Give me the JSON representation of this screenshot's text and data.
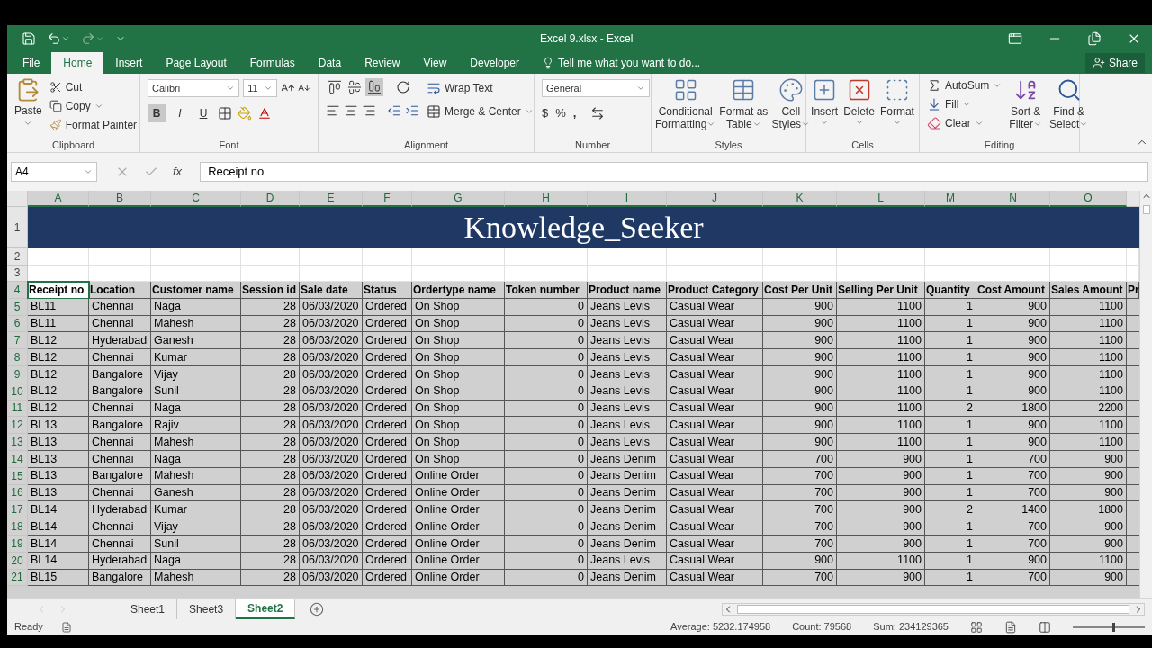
{
  "window": {
    "title": "Excel 9.xlsx - Excel"
  },
  "ribbon_tabs": [
    {
      "label": "File",
      "selected": false
    },
    {
      "label": "Home",
      "selected": true
    },
    {
      "label": "Insert",
      "selected": false
    },
    {
      "label": "Page Layout",
      "selected": false
    },
    {
      "label": "Formulas",
      "selected": false
    },
    {
      "label": "Data",
      "selected": false
    },
    {
      "label": "Review",
      "selected": false
    },
    {
      "label": "View",
      "selected": false
    },
    {
      "label": "Developer",
      "selected": false
    }
  ],
  "tell_me": "Tell me what you want to do...",
  "share": "Share",
  "clipboard": {
    "label": "Clipboard",
    "paste": "Paste",
    "cut": "Cut",
    "copy": "Copy",
    "format_painter": "Format Painter"
  },
  "font": {
    "label": "Font",
    "name": "Calibri",
    "size": "11",
    "styles": [
      {
        "label": "B",
        "on": true
      },
      {
        "label": "I",
        "on": false
      },
      {
        "label": "U",
        "on": false
      }
    ]
  },
  "alignment": {
    "label": "Alignment",
    "vertical": [
      {
        "on": false
      },
      {
        "on": false
      },
      {
        "on": true
      }
    ],
    "wrap_text": "Wrap Text",
    "merge": "Merge & Center"
  },
  "number": {
    "label": "Number",
    "format": "General",
    "currency": "$",
    "percent": "%",
    "comma": ","
  },
  "styles": {
    "label": "Styles",
    "buttons": [
      [
        "Conditional",
        "Formatting"
      ],
      [
        "Format as",
        "Table"
      ],
      [
        "Cell",
        "Styles"
      ]
    ]
  },
  "cells": {
    "label": "Cells",
    "buttons": [
      "Insert",
      "Delete",
      "Format"
    ]
  },
  "editing": {
    "label": "Editing",
    "autosum": "AutoSum",
    "fill": "Fill",
    "clear": "Clear",
    "sort": [
      "Sort &",
      "Filter"
    ],
    "find": [
      "Find &",
      "Select"
    ]
  },
  "formula_bar": {
    "name_box": "A4",
    "fx": "fx",
    "formula": "Receipt no"
  },
  "columns": [
    {
      "letter": "A",
      "selected": true
    },
    {
      "letter": "B",
      "selected": true
    },
    {
      "letter": "C",
      "selected": true
    },
    {
      "letter": "D",
      "selected": true
    },
    {
      "letter": "E",
      "selected": true
    },
    {
      "letter": "F",
      "selected": true
    },
    {
      "letter": "G",
      "selected": true
    },
    {
      "letter": "H",
      "selected": true
    },
    {
      "letter": "I",
      "selected": true
    },
    {
      "letter": "J",
      "selected": true
    },
    {
      "letter": "K",
      "selected": true
    },
    {
      "letter": "L",
      "selected": true
    },
    {
      "letter": "M",
      "selected": true
    },
    {
      "letter": "N",
      "selected": true
    },
    {
      "letter": "O",
      "selected": true
    }
  ],
  "title_row": {
    "number": "1",
    "selected": false,
    "text": "Knowledge_Seeker"
  },
  "blank_rows": [
    {
      "number": "2",
      "selected": false
    },
    {
      "number": "3",
      "selected": false
    }
  ],
  "header_row": {
    "number": "4",
    "selected": true,
    "cells": [
      {
        "text": "Receipt no",
        "active": true
      },
      {
        "text": "Location",
        "active": false
      },
      {
        "text": "Customer name",
        "active": false
      },
      {
        "text": "Session id",
        "active": false
      },
      {
        "text": "Sale date",
        "active": false
      },
      {
        "text": "Status",
        "active": false
      },
      {
        "text": "Ordertype name",
        "active": false
      },
      {
        "text": "Token number",
        "active": false
      },
      {
        "text": "Product name",
        "active": false
      },
      {
        "text": "Product Category",
        "active": false
      },
      {
        "text": "Cost Per Unit",
        "active": false
      },
      {
        "text": "Selling Per Unit",
        "active": false
      },
      {
        "text": "Quantity",
        "active": false
      },
      {
        "text": "Cost Amount",
        "active": false
      },
      {
        "text": "Sales Amount",
        "active": false
      },
      {
        "text": "Pr",
        "active": false
      }
    ]
  },
  "rows": [
    {
      "number": "5",
      "selected": true,
      "cells": [
        "BL11",
        "Chennai",
        "Naga",
        "28",
        "06/03/2020",
        "Ordered",
        "On Shop",
        "0",
        "Jeans Levis",
        "Casual Wear",
        "900",
        "1100",
        "1",
        "900",
        "1100"
      ]
    },
    {
      "number": "6",
      "selected": true,
      "cells": [
        "BL11",
        "Chennai",
        "Mahesh",
        "28",
        "06/03/2020",
        "Ordered",
        "On Shop",
        "0",
        "Jeans Levis",
        "Casual Wear",
        "900",
        "1100",
        "1",
        "900",
        "1100"
      ]
    },
    {
      "number": "7",
      "selected": true,
      "cells": [
        "BL12",
        "Hyderabad",
        "Ganesh",
        "28",
        "06/03/2020",
        "Ordered",
        "On Shop",
        "0",
        "Jeans Levis",
        "Casual Wear",
        "900",
        "1100",
        "1",
        "900",
        "1100"
      ]
    },
    {
      "number": "8",
      "selected": true,
      "cells": [
        "BL12",
        "Chennai",
        "Kumar",
        "28",
        "06/03/2020",
        "Ordered",
        "On Shop",
        "0",
        "Jeans Levis",
        "Casual Wear",
        "900",
        "1100",
        "1",
        "900",
        "1100"
      ]
    },
    {
      "number": "9",
      "selected": true,
      "cells": [
        "BL12",
        "Bangalore",
        "Vijay",
        "28",
        "06/03/2020",
        "Ordered",
        "On Shop",
        "0",
        "Jeans Levis",
        "Casual Wear",
        "900",
        "1100",
        "1",
        "900",
        "1100"
      ]
    },
    {
      "number": "10",
      "selected": true,
      "cells": [
        "BL12",
        "Bangalore",
        "Sunil",
        "28",
        "06/03/2020",
        "Ordered",
        "On Shop",
        "0",
        "Jeans Levis",
        "Casual Wear",
        "900",
        "1100",
        "1",
        "900",
        "1100"
      ]
    },
    {
      "number": "11",
      "selected": true,
      "cells": [
        "BL12",
        "Chennai",
        "Naga",
        "28",
        "06/03/2020",
        "Ordered",
        "On Shop",
        "0",
        "Jeans Levis",
        "Casual Wear",
        "900",
        "1100",
        "2",
        "1800",
        "2200"
      ]
    },
    {
      "number": "12",
      "selected": true,
      "cells": [
        "BL13",
        "Bangalore",
        "Rajiv",
        "28",
        "06/03/2020",
        "Ordered",
        "On Shop",
        "0",
        "Jeans Levis",
        "Casual Wear",
        "900",
        "1100",
        "1",
        "900",
        "1100"
      ]
    },
    {
      "number": "13",
      "selected": true,
      "cells": [
        "BL13",
        "Chennai",
        "Mahesh",
        "28",
        "06/03/2020",
        "Ordered",
        "On Shop",
        "0",
        "Jeans Levis",
        "Casual Wear",
        "900",
        "1100",
        "1",
        "900",
        "1100"
      ]
    },
    {
      "number": "14",
      "selected": true,
      "cells": [
        "BL13",
        "Chennai",
        "Naga",
        "28",
        "06/03/2020",
        "Ordered",
        "On Shop",
        "0",
        "Jeans Denim",
        "Casual Wear",
        "700",
        "900",
        "1",
        "700",
        "900"
      ]
    },
    {
      "number": "15",
      "selected": true,
      "cells": [
        "BL13",
        "Bangalore",
        "Mahesh",
        "28",
        "06/03/2020",
        "Ordered",
        "Online Order",
        "0",
        "Jeans Denim",
        "Casual Wear",
        "700",
        "900",
        "1",
        "700",
        "900"
      ]
    },
    {
      "number": "16",
      "selected": true,
      "cells": [
        "BL13",
        "Chennai",
        "Ganesh",
        "28",
        "06/03/2020",
        "Ordered",
        "Online Order",
        "0",
        "Jeans Denim",
        "Casual Wear",
        "700",
        "900",
        "1",
        "700",
        "900"
      ]
    },
    {
      "number": "17",
      "selected": true,
      "cells": [
        "BL14",
        "Hyderabad",
        "Kumar",
        "28",
        "06/03/2020",
        "Ordered",
        "Online Order",
        "0",
        "Jeans Denim",
        "Casual Wear",
        "700",
        "900",
        "2",
        "1400",
        "1800"
      ]
    },
    {
      "number": "18",
      "selected": true,
      "cells": [
        "BL14",
        "Chennai",
        "Vijay",
        "28",
        "06/03/2020",
        "Ordered",
        "Online Order",
        "0",
        "Jeans Denim",
        "Casual Wear",
        "700",
        "900",
        "1",
        "700",
        "900"
      ]
    },
    {
      "number": "19",
      "selected": true,
      "cells": [
        "BL14",
        "Chennai",
        "Sunil",
        "28",
        "06/03/2020",
        "Ordered",
        "Online Order",
        "0",
        "Jeans Denim",
        "Casual Wear",
        "700",
        "900",
        "1",
        "700",
        "900"
      ]
    },
    {
      "number": "20",
      "selected": true,
      "cells": [
        "BL14",
        "Hyderabad",
        "Naga",
        "28",
        "06/03/2020",
        "Ordered",
        "Online Order",
        "0",
        "Jeans Levis",
        "Casual Wear",
        "900",
        "1100",
        "1",
        "900",
        "1100"
      ]
    },
    {
      "number": "21",
      "selected": true,
      "cells": [
        "BL15",
        "Bangalore",
        "Mahesh",
        "28",
        "06/03/2020",
        "Ordered",
        "Online Order",
        "0",
        "Jeans Denim",
        "Casual Wear",
        "700",
        "900",
        "1",
        "700",
        "900"
      ]
    }
  ],
  "sheets": [
    {
      "label": "Sheet1",
      "selected": false
    },
    {
      "label": "Sheet3",
      "selected": false
    },
    {
      "label": "Sheet2",
      "selected": true
    }
  ],
  "zoom": {
    "level": 0.55
  },
  "status_bar": {
    "mode": "Ready",
    "average": "Average: 5232.174958",
    "count": "Count: 79568",
    "sum": "Sum: 234129365"
  }
}
